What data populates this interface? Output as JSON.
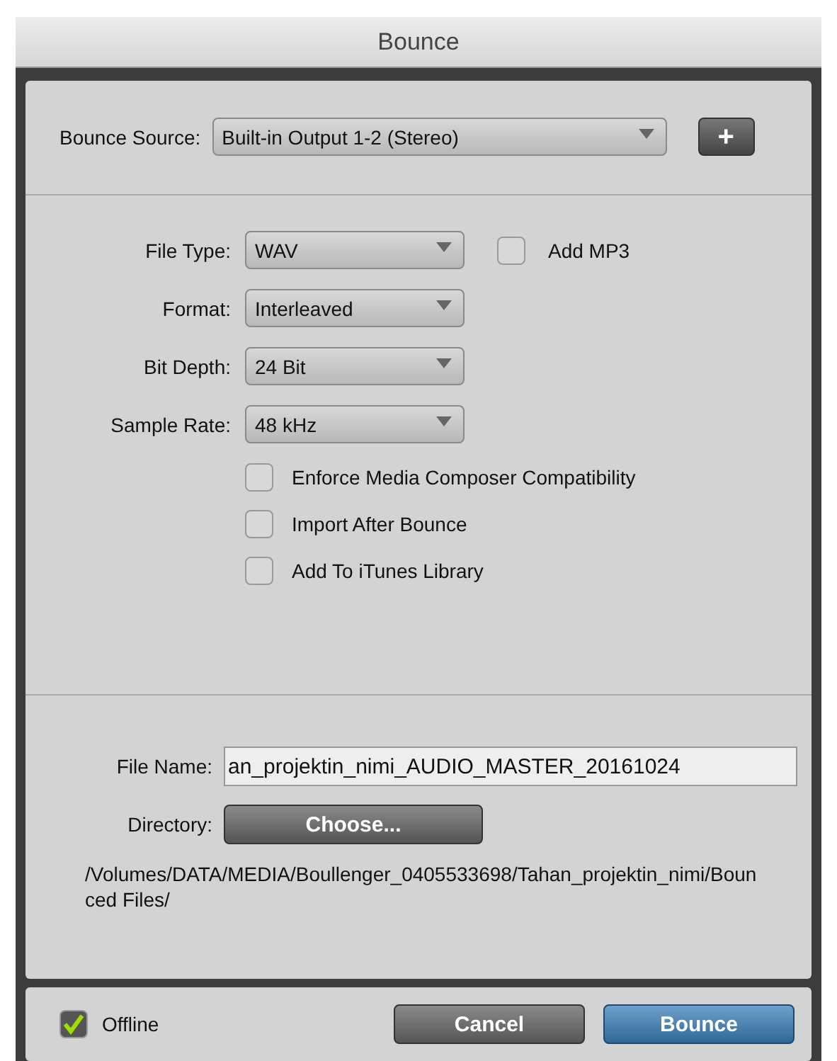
{
  "window": {
    "title": "Bounce"
  },
  "bounce_source": {
    "label": "Bounce Source:",
    "value": "Built-in Output 1-2 (Stereo)",
    "add_button": "+"
  },
  "settings": [
    {
      "label": "File Type:",
      "value": "WAV"
    },
    {
      "label": "Format:",
      "value": "Interleaved"
    },
    {
      "label": "Bit Depth:",
      "value": "24 Bit"
    },
    {
      "label": "Sample Rate:",
      "value": "48 kHz"
    }
  ],
  "add_mp3": {
    "label": "Add MP3",
    "checked": false
  },
  "options": [
    {
      "label": "Enforce Media Composer Compatibility",
      "checked": false
    },
    {
      "label": "Import After Bounce",
      "checked": false
    },
    {
      "label": "Add To iTunes Library",
      "checked": false
    }
  ],
  "file_name": {
    "label": "File Name:",
    "value": "an_projektin_nimi_AUDIO_MASTER_20161024"
  },
  "directory": {
    "label": "Directory:",
    "button": "Choose...",
    "path": "/Volumes/DATA/MEDIA/Boullenger_0405533698/Tahan_projektin_nimi/Bounced Files/"
  },
  "footer": {
    "offline": {
      "label": "Offline",
      "checked": true
    },
    "buttons": [
      {
        "label": "Cancel",
        "kind": "default"
      },
      {
        "label": "Bounce",
        "kind": "primary"
      }
    ]
  }
}
